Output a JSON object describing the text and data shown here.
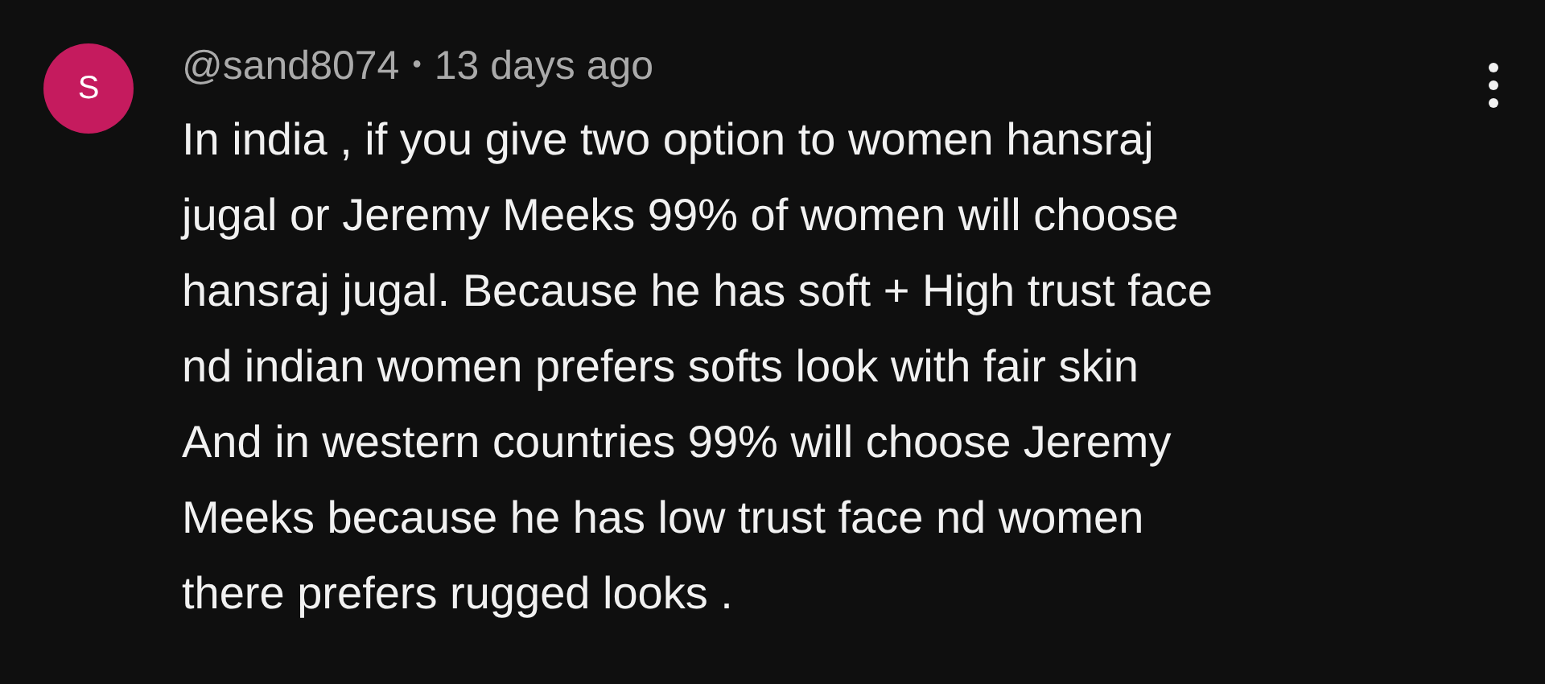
{
  "comment": {
    "avatar_letter": "S",
    "author": "@sand8074",
    "separator": "•",
    "time": "13 days ago",
    "body_lines": [
      "In india , if you give two option to women hansraj",
      "jugal or Jeremy Meeks 99% of women will choose",
      "hansraj jugal. Because he has soft + High trust face",
      "nd indian women prefers softs look with fair skin",
      "And in western countries 99% will choose Jeremy",
      "Meeks because he has low trust face nd women",
      "there prefers rugged looks ."
    ]
  }
}
